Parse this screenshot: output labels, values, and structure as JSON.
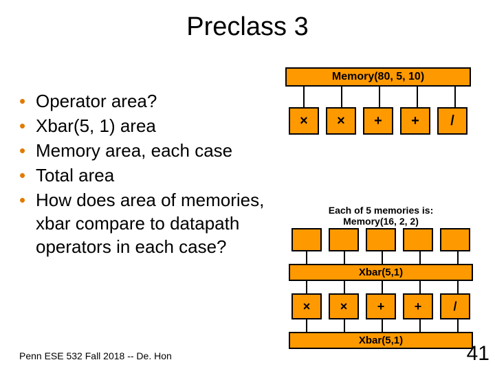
{
  "title": "Preclass 3",
  "bullets": [
    "Operator area?",
    "Xbar(5, 1) area",
    "Memory area, each case",
    "Total area",
    "How does area of memories, xbar compare to datapath operators in each case?"
  ],
  "footer": "Penn ESE 532 Fall 2018 -- De. Hon",
  "page_number": "41",
  "diagram1": {
    "memory_label": "Memory(80, 5, 10)",
    "operators": [
      "×",
      "×",
      "+",
      "+",
      "/"
    ]
  },
  "diagram2": {
    "caption_line1": "Each of 5 memories is:",
    "caption_line2": "Memory(16, 2, 2)",
    "xbar_top_label": "Xbar(5,1)",
    "operators": [
      "×",
      "×",
      "+",
      "+",
      "/"
    ],
    "xbar_bottom_label": "Xbar(5,1)"
  }
}
